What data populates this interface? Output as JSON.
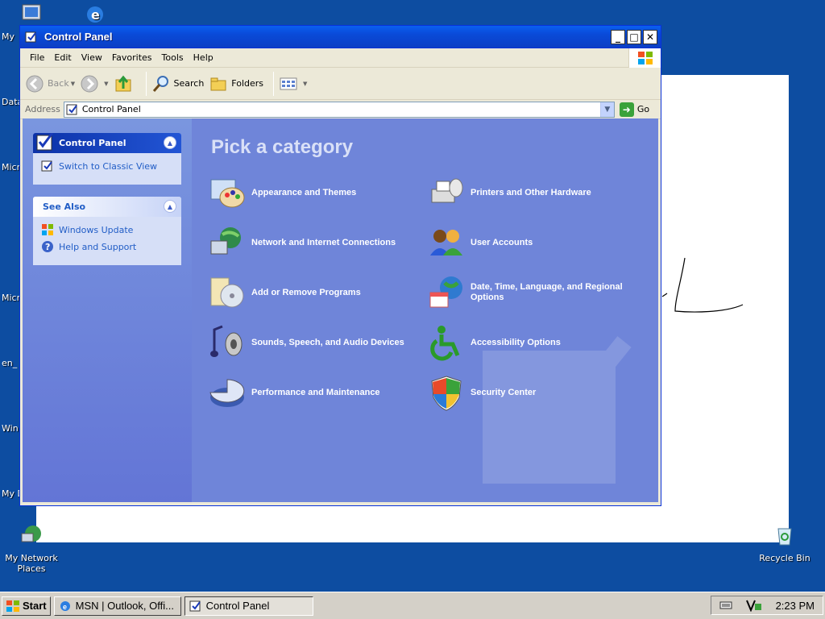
{
  "desktop": {
    "icons": [
      {
        "label": "My Network Places"
      },
      {
        "label": "Recycle Bin"
      }
    ],
    "left_labels": [
      "My",
      "Data",
      "Micro C",
      "Micro B",
      "en_",
      "Win",
      "My D"
    ]
  },
  "window": {
    "title": "Control Panel",
    "menu": [
      "File",
      "Edit",
      "View",
      "Favorites",
      "Tools",
      "Help"
    ],
    "toolbar": {
      "back": "Back",
      "search": "Search",
      "folders": "Folders"
    },
    "address": {
      "label": "Address",
      "value": "Control Panel",
      "go": "Go"
    }
  },
  "taskpane": {
    "main_box": {
      "title": "Control Panel",
      "link": "Switch to Classic View"
    },
    "see_also": {
      "title": "See Also",
      "links": [
        "Windows Update",
        "Help and Support"
      ]
    }
  },
  "main": {
    "heading": "Pick a category",
    "categories": [
      "Appearance and Themes",
      "Printers and Other Hardware",
      "Network and Internet Connections",
      "User Accounts",
      "Add or Remove Programs",
      "Date, Time, Language, and Regional Options",
      "Sounds, Speech, and Audio Devices",
      "Accessibility Options",
      "Performance and Maintenance",
      "Security Center"
    ]
  },
  "taskbar": {
    "start": "Start",
    "tasks": [
      "MSN | Outlook, Offi...",
      "Control Panel"
    ],
    "clock": "2:23 PM"
  }
}
